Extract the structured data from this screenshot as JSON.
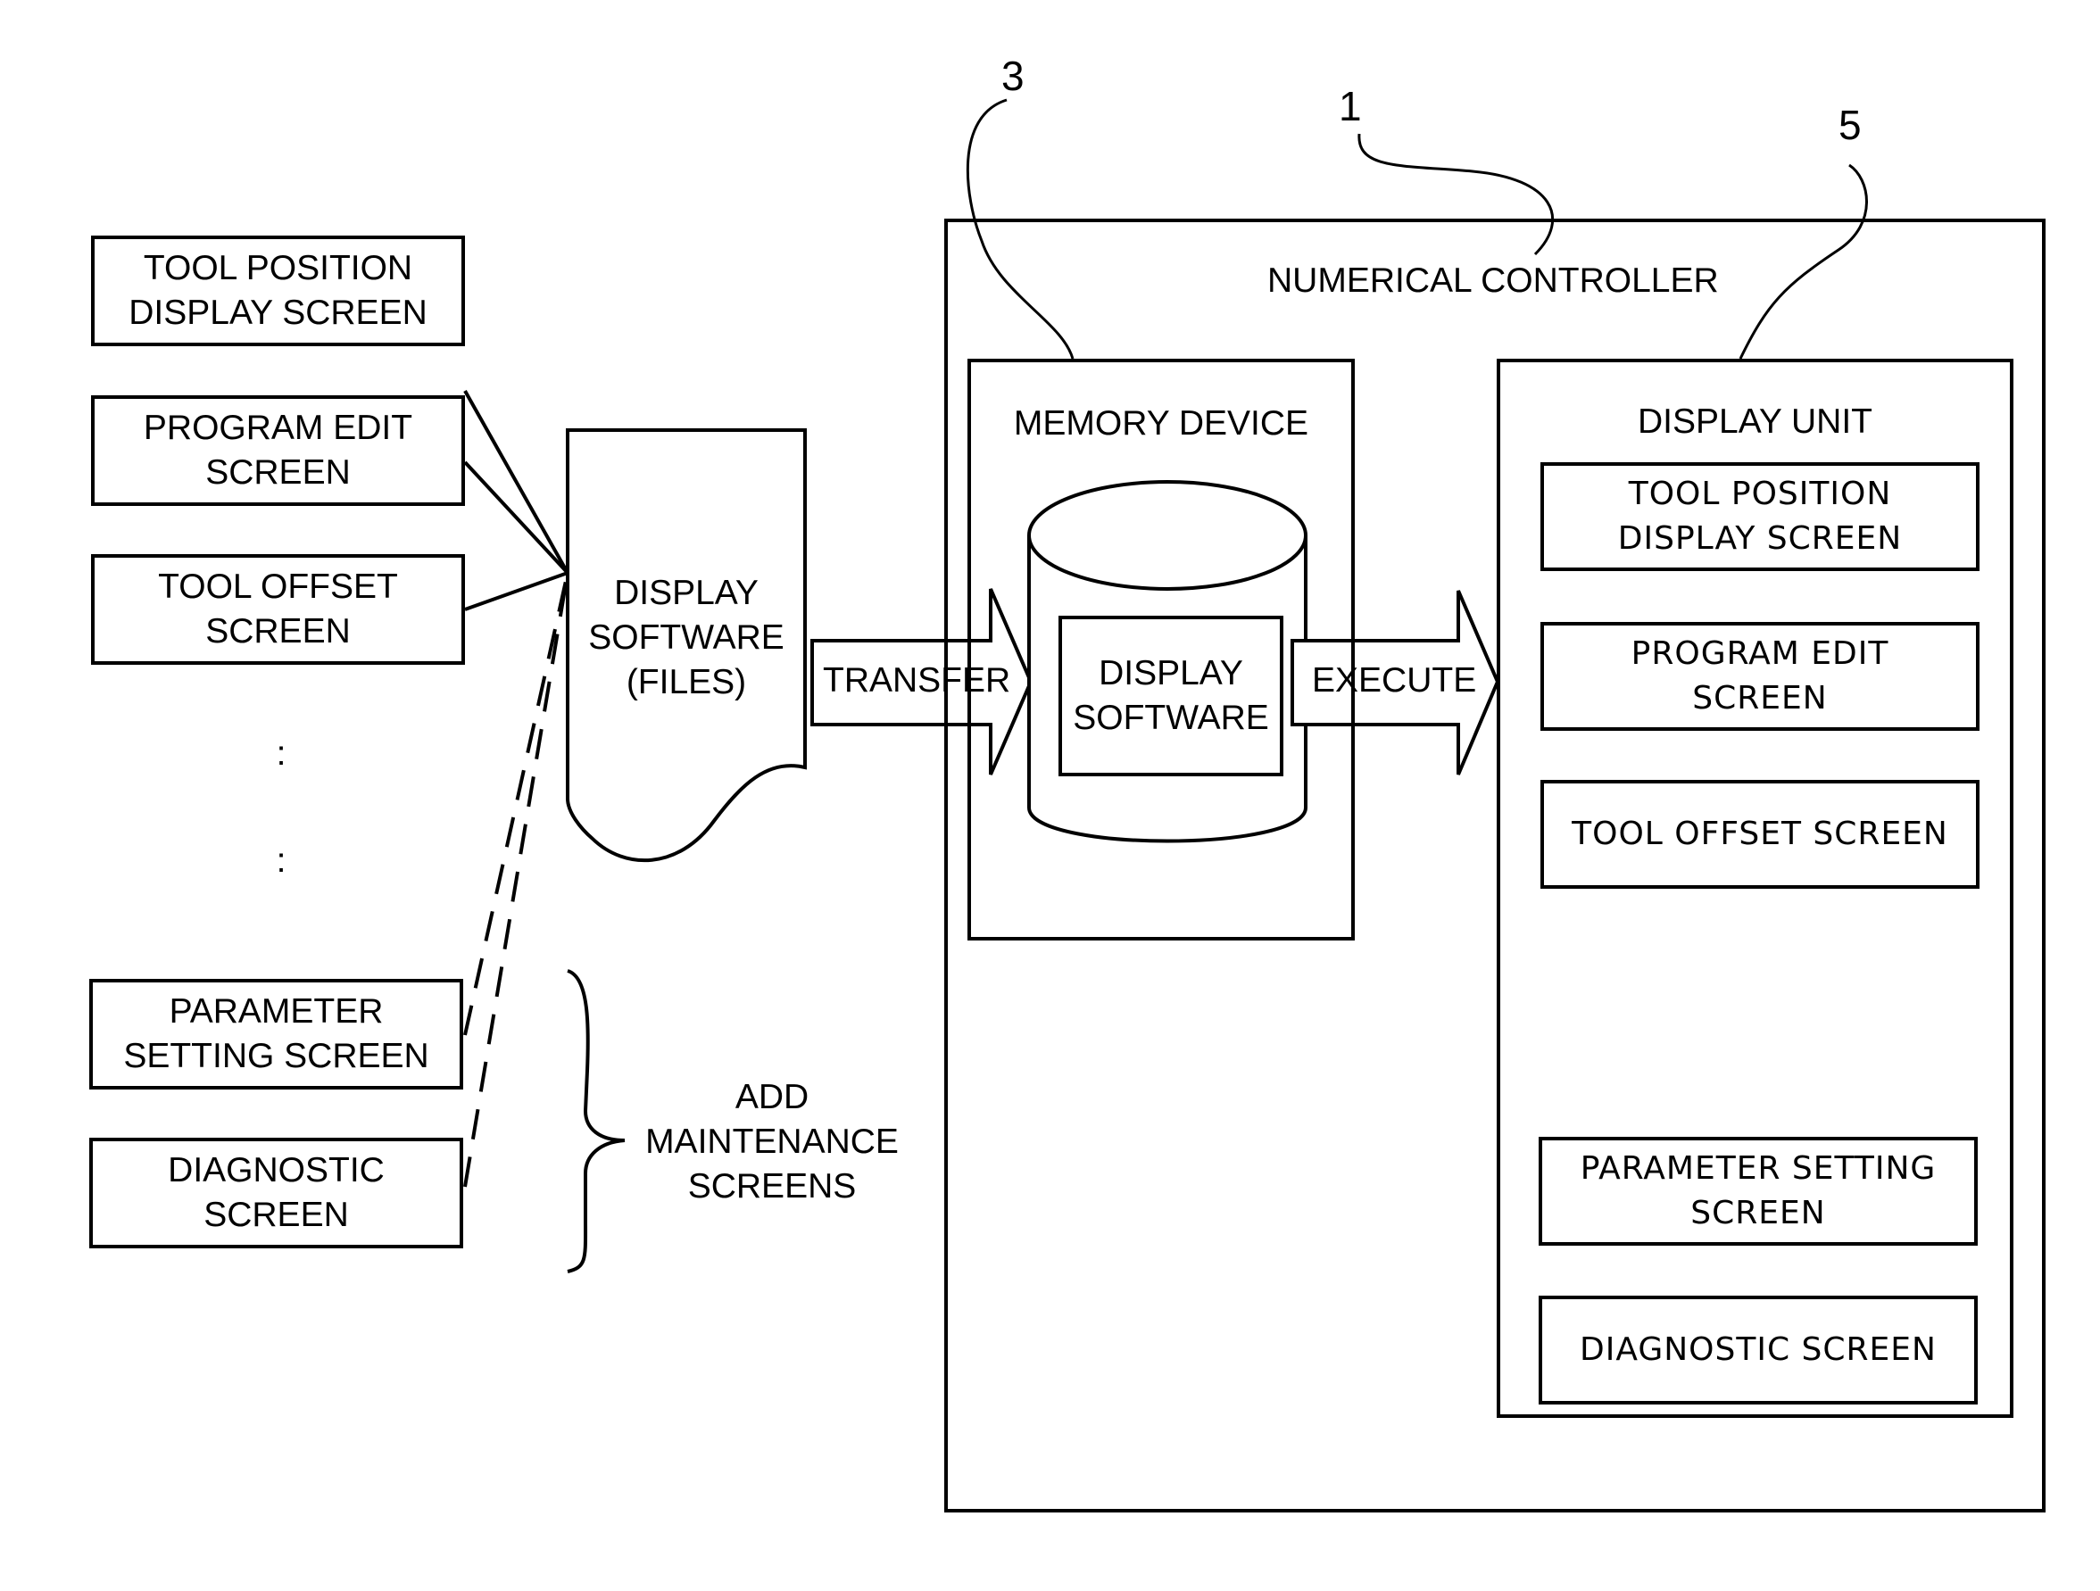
{
  "left_screens": [
    {
      "line1": "TOOL POSITION",
      "line2": "DISPLAY SCREEN"
    },
    {
      "line1": "PROGRAM EDIT",
      "line2": "SCREEN"
    },
    {
      "line1": "TOOL OFFSET",
      "line2": "SCREEN"
    },
    {
      "line1": "PARAMETER",
      "line2": "SETTING SCREEN"
    },
    {
      "line1": "DIAGNOSTIC",
      "line2": "SCREEN"
    }
  ],
  "ellipsis": [
    ":",
    ":"
  ],
  "file": {
    "line1": "DISPLAY",
    "line2": "SOFTWARE",
    "line3": "(FILES)"
  },
  "brace_label": {
    "line1": "ADD",
    "line2": "MAINTENANCE",
    "line3": "SCREENS"
  },
  "arrows": {
    "transfer": "TRANSFER",
    "execute": "EXECUTE"
  },
  "controller": {
    "title": "NUMERICAL CONTROLLER",
    "ref": "1"
  },
  "memory": {
    "title": "MEMORY DEVICE",
    "ref": "3",
    "software_line1": "DISPLAY",
    "software_line2": "SOFTWARE"
  },
  "display_unit": {
    "title": "DISPLAY UNIT",
    "ref": "5",
    "screens": [
      {
        "line1": "TOOL POSITION",
        "line2": "DISPLAY SCREEN"
      },
      {
        "line1": "PROGRAM EDIT",
        "line2": "SCREEN"
      },
      {
        "line1": "TOOL OFFSET SCREEN",
        "line2": ""
      },
      {
        "line1": "PARAMETER SETTING",
        "line2": "SCREEN"
      },
      {
        "line1": "DIAGNOSTIC SCREEN",
        "line2": ""
      }
    ]
  }
}
